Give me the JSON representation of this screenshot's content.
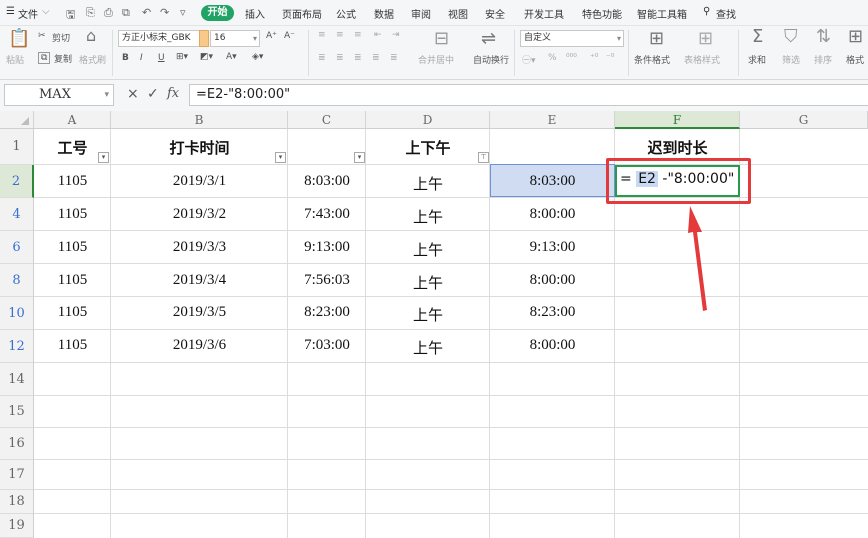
{
  "menubar": {
    "file_label": "文件",
    "tabs": [
      "开始",
      "插入",
      "页面布局",
      "公式",
      "数据",
      "审阅",
      "视图",
      "安全",
      "开发工具",
      "特色功能",
      "智能工具箱"
    ],
    "search_label": "查找"
  },
  "ribbon": {
    "paste_label": "粘贴",
    "cut_label": "剪切",
    "copy_label": "复制",
    "format_painter_label": "格式刷",
    "font_name": "方正小标宋_GBK",
    "font_size": "16",
    "merge_label": "合并居中",
    "wrap_label": "自动换行",
    "number_format": "自定义",
    "conditional_format_label": "条件格式",
    "table_style_label": "表格样式",
    "sum_label": "求和",
    "filter_label": "筛选",
    "sort_label": "排序",
    "format_label": "格式"
  },
  "formula_bar": {
    "name_box": "MAX",
    "cancel_icon": "×",
    "confirm_icon": "✓",
    "fx_label": "fx",
    "formula": "=E2-\"8:00:00\""
  },
  "grid": {
    "columns": [
      "A",
      "B",
      "C",
      "D",
      "E",
      "F",
      "G"
    ],
    "selected_column": "F",
    "header_row": {
      "row_num": "1",
      "A": "工号",
      "B": "打卡时间",
      "C": "",
      "D": "上下午",
      "E": "",
      "F": "迟到时长"
    },
    "rows": [
      {
        "row_num": "2",
        "A": "1105",
        "B": "2019/3/1",
        "C": "8:03:00",
        "D": "上午",
        "E": "8:03:00"
      },
      {
        "row_num": "4",
        "A": "1105",
        "B": "2019/3/2",
        "C": "7:43:00",
        "D": "上午",
        "E": "8:00:00"
      },
      {
        "row_num": "6",
        "A": "1105",
        "B": "2019/3/3",
        "C": "9:13:00",
        "D": "上午",
        "E": "9:13:00"
      },
      {
        "row_num": "8",
        "A": "1105",
        "B": "2019/3/4",
        "C": "7:56:03",
        "D": "上午",
        "E": "8:00:00"
      },
      {
        "row_num": "10",
        "A": "1105",
        "B": "2019/3/5",
        "C": "8:23:00",
        "D": "上午",
        "E": "8:23:00"
      },
      {
        "row_num": "12",
        "A": "1105",
        "B": "2019/3/6",
        "C": "7:03:00",
        "D": "上午",
        "E": "8:00:00"
      }
    ],
    "empty_rows": [
      "14",
      "15",
      "16",
      "17",
      "18",
      "19"
    ],
    "editing_cell": {
      "prefix": "= ",
      "ref": "E2",
      "suffix": " -\"8:00:00\""
    }
  },
  "colors": {
    "accent_green": "#21a366",
    "selection_blue": "#cfdcf2",
    "annotation_red": "#e33b3b"
  }
}
